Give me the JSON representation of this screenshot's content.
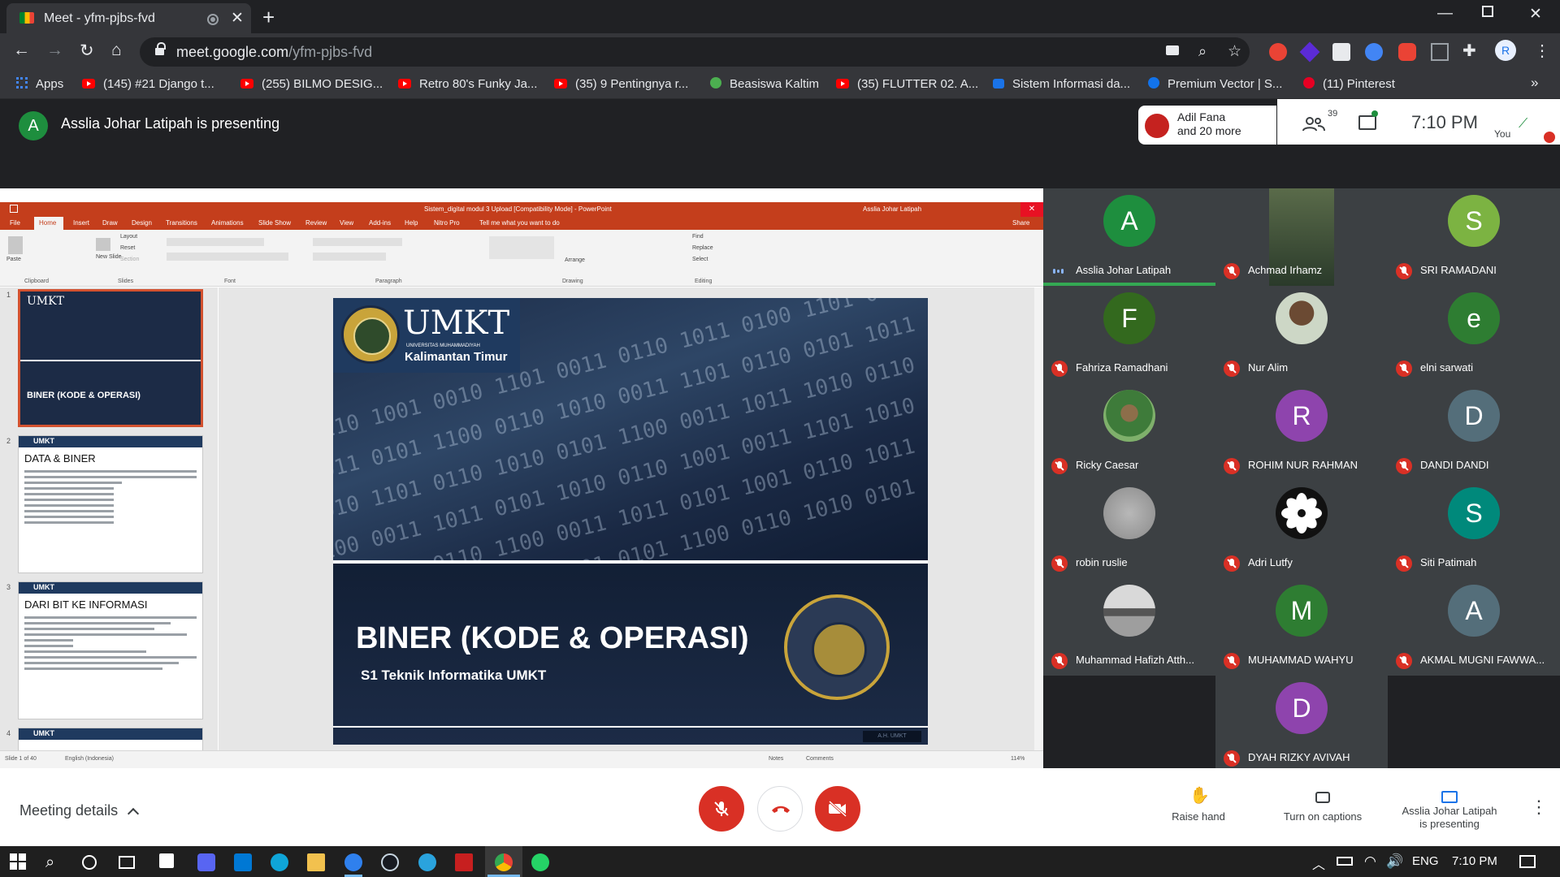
{
  "browser": {
    "tab_title": "Meet - yfm-pjbs-fvd",
    "url_host": "meet.google.com",
    "url_path": "/yfm-pjbs-fvd",
    "bookmarks": [
      {
        "label": "Apps",
        "icon": "apps-grid-icon"
      },
      {
        "label": "(145) #21 Django t...",
        "icon": "youtube-icon"
      },
      {
        "label": "(255) BILMO DESIG...",
        "icon": "youtube-icon"
      },
      {
        "label": "Retro 80's Funky Ja...",
        "icon": "youtube-icon"
      },
      {
        "label": "(35) 9 Pentingnya r...",
        "icon": "youtube-icon"
      },
      {
        "label": "Beasiswa Kaltim",
        "icon": "globe-icon"
      },
      {
        "label": "(35) FLUTTER 02. A...",
        "icon": "youtube-icon"
      },
      {
        "label": "Sistem Informasi da...",
        "icon": "site-icon"
      },
      {
        "label": "Premium Vector | S...",
        "icon": "freepik-icon"
      },
      {
        "label": "(11) Pinterest",
        "icon": "pinterest-icon"
      }
    ],
    "more_bookmarks": "»"
  },
  "meet": {
    "presenter_initial": "A",
    "presenter_banner": "Asslia Johar Latipah is presenting",
    "people_chip": {
      "line1": "Adil Fana",
      "line2": "and 20 more"
    },
    "participant_count": "39",
    "time": "7:10 PM",
    "you_label": "You",
    "colors": {
      "accent_red": "#d93025",
      "meet_green": "#1e8e3e",
      "tile_bg": "#3c4043"
    }
  },
  "powerpoint": {
    "window_title": "Sistem_digital modul 3 Upload [Compatibility Mode] - PowerPoint",
    "user": "Asslia Johar Latipah",
    "tabs": [
      "File",
      "Home",
      "Insert",
      "Draw",
      "Design",
      "Transitions",
      "Animations",
      "Slide Show",
      "Review",
      "View",
      "Add-ins",
      "Help",
      "Nitro Pro",
      "Tell me what you want to do"
    ],
    "share": "Share",
    "ribbon_groups": [
      "Clipboard",
      "Slides",
      "Font",
      "Paragraph",
      "Drawing",
      "Editing"
    ],
    "ribbon_items": {
      "paste": "Paste",
      "new_slide": "New Slide",
      "layout": "Layout",
      "reset": "Reset",
      "section": "Section",
      "arrange": "Arrange",
      "find": "Find",
      "replace": "Replace",
      "select": "Select"
    },
    "thumbnails": [
      {
        "num": "1",
        "title": "BINER (KODE & OPERASI)",
        "brand": "UMKT"
      },
      {
        "num": "2",
        "title": "DATA & BINER",
        "brand": "UMKT"
      },
      {
        "num": "3",
        "title": "DARI BIT KE INFORMASI",
        "brand": "UMKT"
      },
      {
        "num": "4",
        "title": "",
        "brand": "UMKT"
      }
    ],
    "slide": {
      "brand": "UMKT",
      "brand_small": "UNIVERSITAS MUHAMMADIYAH",
      "brand_sub": "Kalimantan Timur",
      "title": "BINER (KODE & OPERASI)",
      "subtitle": "S1 Teknik Informatika UMKT",
      "corner": "A.H. UMKT"
    },
    "status": {
      "slide": "Slide 1 of 40",
      "language": "English (Indonesia)",
      "notes": "Notes",
      "comments": "Comments",
      "zoom": "114%"
    }
  },
  "participants": [
    {
      "name": "Asslia Johar Latipah",
      "initial": "A",
      "color": "#1e8e3e",
      "speaking": true,
      "muted": false
    },
    {
      "name": "Achmad Irhamz",
      "initial": "",
      "color": "#4a5a3c",
      "speaking": false,
      "muted": true,
      "video": true
    },
    {
      "name": "SRI RAMADANI",
      "initial": "S",
      "color": "#7cb342",
      "speaking": false,
      "muted": true
    },
    {
      "name": "Fahriza Ramadhani",
      "initial": "F",
      "color": "#33691e",
      "speaking": false,
      "muted": true
    },
    {
      "name": "Nur Alim",
      "initial": "",
      "color": "#8d8f7a",
      "speaking": false,
      "muted": true,
      "photo": true
    },
    {
      "name": "elni sarwati",
      "initial": "e",
      "color": "#2e7d32",
      "speaking": false,
      "muted": true
    },
    {
      "name": "Ricky Caesar",
      "initial": "",
      "color": "#4caf50",
      "speaking": false,
      "muted": true,
      "photo": true
    },
    {
      "name": "ROHIM NUR RAHMAN",
      "initial": "R",
      "color": "#8e44ad",
      "speaking": false,
      "muted": true
    },
    {
      "name": "DANDI DANDI",
      "initial": "D",
      "color": "#546e7a",
      "speaking": false,
      "muted": true
    },
    {
      "name": "robin ruslie",
      "initial": "",
      "color": "#9e9e9e",
      "speaking": false,
      "muted": true,
      "photo": true
    },
    {
      "name": "Adri Lutfy",
      "initial": "",
      "color": "#111111",
      "speaking": false,
      "muted": true,
      "photo": true
    },
    {
      "name": "Siti Patimah",
      "initial": "S",
      "color": "#00897b",
      "speaking": false,
      "muted": true
    },
    {
      "name": "Muhammad Hafizh Atth...",
      "initial": "",
      "color": "#757575",
      "speaking": false,
      "muted": true,
      "photo": true
    },
    {
      "name": "MUHAMMAD WAHYU",
      "initial": "M",
      "color": "#2e7d32",
      "speaking": false,
      "muted": true
    },
    {
      "name": "AKMAL MUGNI FAWWA...",
      "initial": "A",
      "color": "#546e7a",
      "speaking": false,
      "muted": true
    },
    {
      "name": "DYAH RIZKY AVIVAH",
      "initial": "D",
      "color": "#8e44ad",
      "speaking": false,
      "muted": true
    }
  ],
  "bottom": {
    "meeting_details": "Meeting details",
    "raise_hand": "Raise hand",
    "captions": "Turn on captions",
    "presenting_line1": "Asslia Johar Latipah",
    "presenting_line2": "is presenting"
  },
  "taskbar": {
    "lang": "ENG",
    "time": "7:10 PM"
  }
}
